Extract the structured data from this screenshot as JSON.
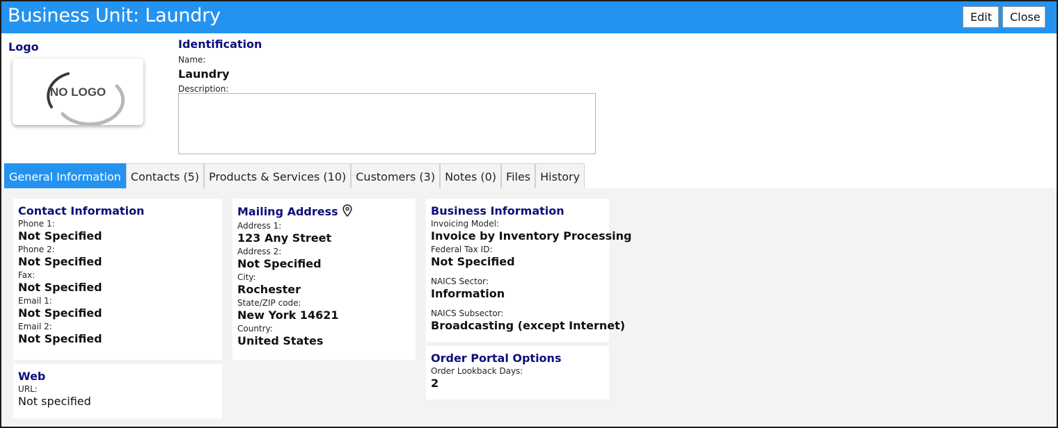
{
  "window": {
    "title": "Business Unit: Laundry",
    "edit_label": "Edit",
    "close_label": "Close",
    "titlebar_color": "#2493f0"
  },
  "logo": {
    "section_title": "Logo",
    "placeholder_text": "NO LOGO"
  },
  "identification": {
    "section_title": "Identification",
    "name_label": "Name:",
    "name_value": "Laundry",
    "description_label": "Description:",
    "description_value": ""
  },
  "tabs": [
    {
      "label": "General Information",
      "active": true
    },
    {
      "label": "Contacts (5)",
      "active": false
    },
    {
      "label": "Products & Services (10)",
      "active": false
    },
    {
      "label": "Customers (3)",
      "active": false
    },
    {
      "label": "Notes (0)",
      "active": false
    },
    {
      "label": "Files",
      "active": false
    },
    {
      "label": "History",
      "active": false
    }
  ],
  "contact_info": {
    "title": "Contact Information",
    "fields": [
      {
        "label": "Phone 1:",
        "value": "Not Specified"
      },
      {
        "label": "Phone 2:",
        "value": "Not Specified"
      },
      {
        "label": "Fax:",
        "value": "Not Specified"
      },
      {
        "label": "Email 1:",
        "value": "Not Specified"
      },
      {
        "label": "Email 2:",
        "value": "Not Specified"
      }
    ]
  },
  "web": {
    "title": "Web",
    "url_label": "URL:",
    "url_value": "Not specified"
  },
  "mailing_address": {
    "title": "Mailing Address",
    "icon": "map-pin-icon",
    "fields": [
      {
        "label": "Address 1:",
        "value": "123 Any Street"
      },
      {
        "label": "Address 2:",
        "value": "Not Specified"
      },
      {
        "label": "City:",
        "value": "Rochester"
      },
      {
        "label": "State/ZIP code:",
        "value": "New York 14621"
      },
      {
        "label": "Country:",
        "value": "United States"
      }
    ]
  },
  "business_info": {
    "title": "Business Information",
    "fields": [
      {
        "label": "Invoicing Model:",
        "value": "Invoice by Inventory Processing"
      },
      {
        "label": "Federal Tax ID:",
        "value": "Not Specified"
      },
      {
        "label": "NAICS Sector:",
        "value": "Information"
      },
      {
        "label": "NAICS Subsector:",
        "value": "Broadcasting (except Internet)"
      }
    ]
  },
  "order_portal": {
    "title": "Order Portal Options",
    "lookback_label": "Order Lookback Days:",
    "lookback_value": "2"
  }
}
